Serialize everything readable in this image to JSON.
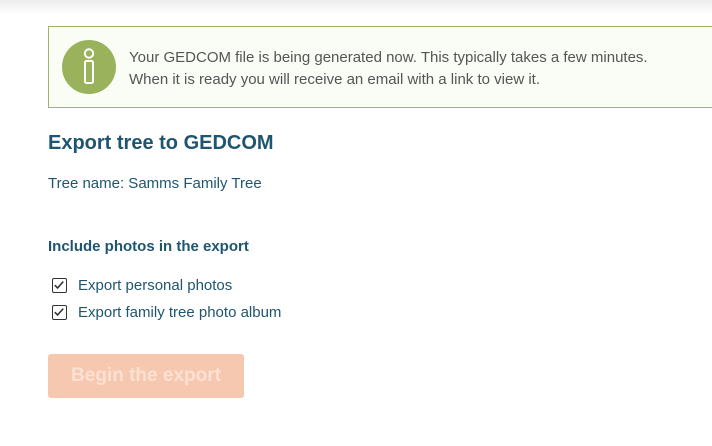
{
  "notice": {
    "icon": "info-icon",
    "line1": "Your GEDCOM file is being generated now. This typically takes a few minutes.",
    "line2": "When it is ready you will receive an email with a link to view it.",
    "accent_color": "#9ab25c"
  },
  "export": {
    "title": "Export tree to GEDCOM",
    "tree_name": "Tree name: Samms Family Tree",
    "photos_section_title": "Include photos in the export",
    "options": [
      {
        "label": "Export personal photos",
        "checked": true
      },
      {
        "label": "Export family tree photo album",
        "checked": true
      }
    ],
    "begin_button_label": "Begin the export",
    "begin_button_state": "disabled"
  },
  "colors": {
    "heading": "#1f5570",
    "button_disabled_bg": "#f7c8b0"
  }
}
